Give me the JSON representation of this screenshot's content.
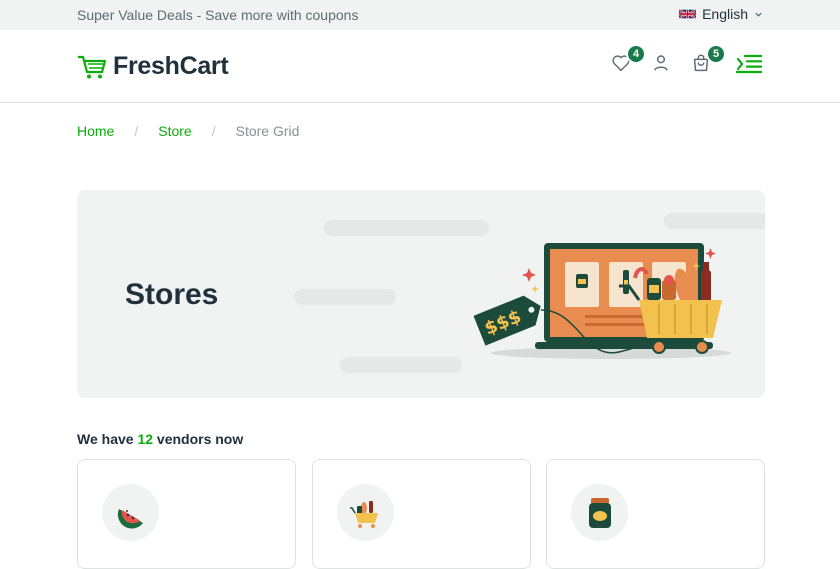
{
  "topbar": {
    "promo": "Super Value Deals - Save more with coupons",
    "language": "English",
    "language_flag": "uk-flag-icon"
  },
  "header": {
    "brand": "FreshCart",
    "logo_icon": "shopping-cart-icon",
    "wishlist_count": "4",
    "cart_count": "5",
    "accent": "#0aad0a",
    "badge_color": "#1a7a4a"
  },
  "breadcrumb": {
    "items": [
      "Home",
      "Store",
      "Store Grid"
    ]
  },
  "hero": {
    "title": "Stores",
    "price_tag": "$$$"
  },
  "vendors": {
    "prefix": "We have",
    "count": "12",
    "suffix": "vendors now",
    "cards": [
      {
        "icon": "watermelon-icon"
      },
      {
        "icon": "grocery-cart-icon"
      },
      {
        "icon": "jar-icon"
      }
    ]
  }
}
